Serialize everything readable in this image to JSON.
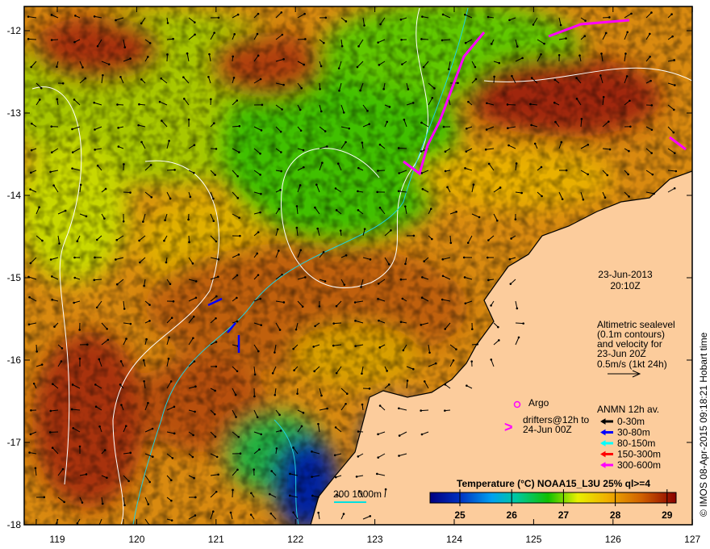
{
  "map": {
    "lat_ticks": [
      "-12",
      "-13",
      "-14",
      "-15",
      "-16",
      "-17",
      "-18"
    ],
    "lon_ticks": [
      "119",
      "120",
      "121",
      "122",
      "123",
      "124",
      "125",
      "126",
      "127"
    ],
    "date": "23-Jun-2013",
    "time": "20:10Z",
    "altimetry_note": [
      "Altimetric sealevel",
      "(0.1m contours)",
      "and velocity for",
      "23-Jun 20Z",
      "0.5m/s (1kt 24h)"
    ],
    "argo_label": "Argo",
    "drifters_label": [
      "drifters@12h to",
      "24-Jun 00Z"
    ],
    "drifter_symbol": ">",
    "anmn_title": "ANMN 12h av.",
    "anmn_items": [
      {
        "label": "0-30m",
        "color": "#000000"
      },
      {
        "label": "30-80m",
        "color": "#0000ff"
      },
      {
        "label": "80-150m",
        "color": "#00ffff"
      },
      {
        "label": "150-300m",
        "color": "#ff0000"
      },
      {
        "label": "300-600m",
        "color": "#ff00ff"
      }
    ],
    "depth_contours_label": "200  1000m",
    "colorbar_title": "Temperature (°C) NOAA15_L3U 25% ql>=4",
    "colorbar_ticks": [
      "25",
      "26",
      "27",
      "28",
      "29"
    ],
    "credit": "© IMOS 08-Apr-2015 09:18:21 Hobart time",
    "colors": {
      "land": "#fccc9c",
      "sea_warm": "#d9820a",
      "cold": "#0a1a9a"
    }
  }
}
